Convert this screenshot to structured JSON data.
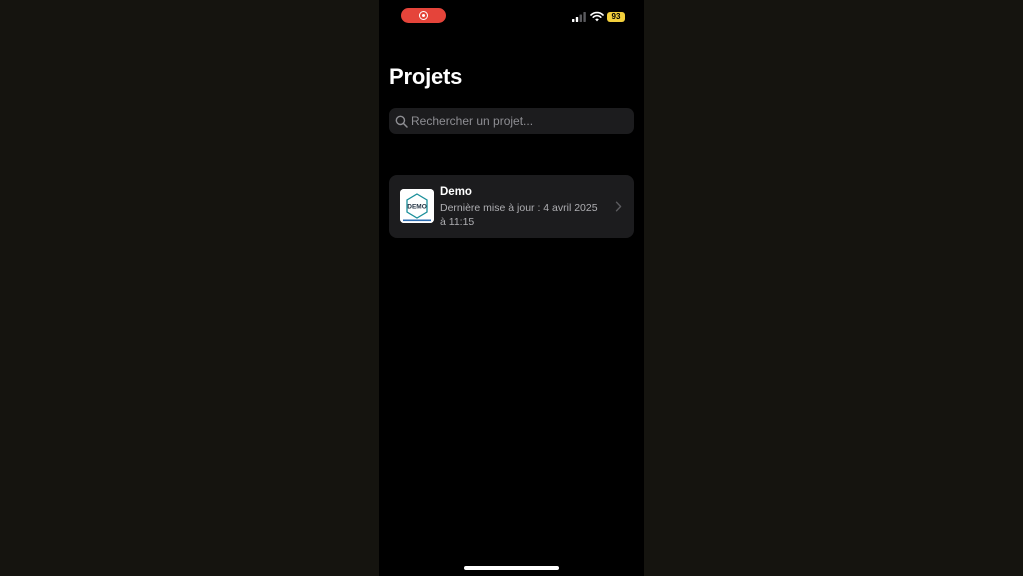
{
  "status_bar": {
    "battery_level": "93",
    "icons": [
      "screen-record-icon",
      "cellular-signal-icon",
      "wifi-icon",
      "battery-icon"
    ],
    "record_color": "#e5443a",
    "battery_color": "#f2cf3c"
  },
  "header": {
    "title": "Projets"
  },
  "search": {
    "placeholder": "Rechercher un projet...",
    "value": ""
  },
  "projects": [
    {
      "name": "Demo",
      "thumbnail_text": "DEMO",
      "updated_line1": "Dernière mise à jour : 4 avril 2025",
      "updated_line2": "à 11:15"
    }
  ],
  "colors": {
    "background": "#000000",
    "card": "#1c1c1e",
    "accent_thumb": "#1a8f9a"
  }
}
